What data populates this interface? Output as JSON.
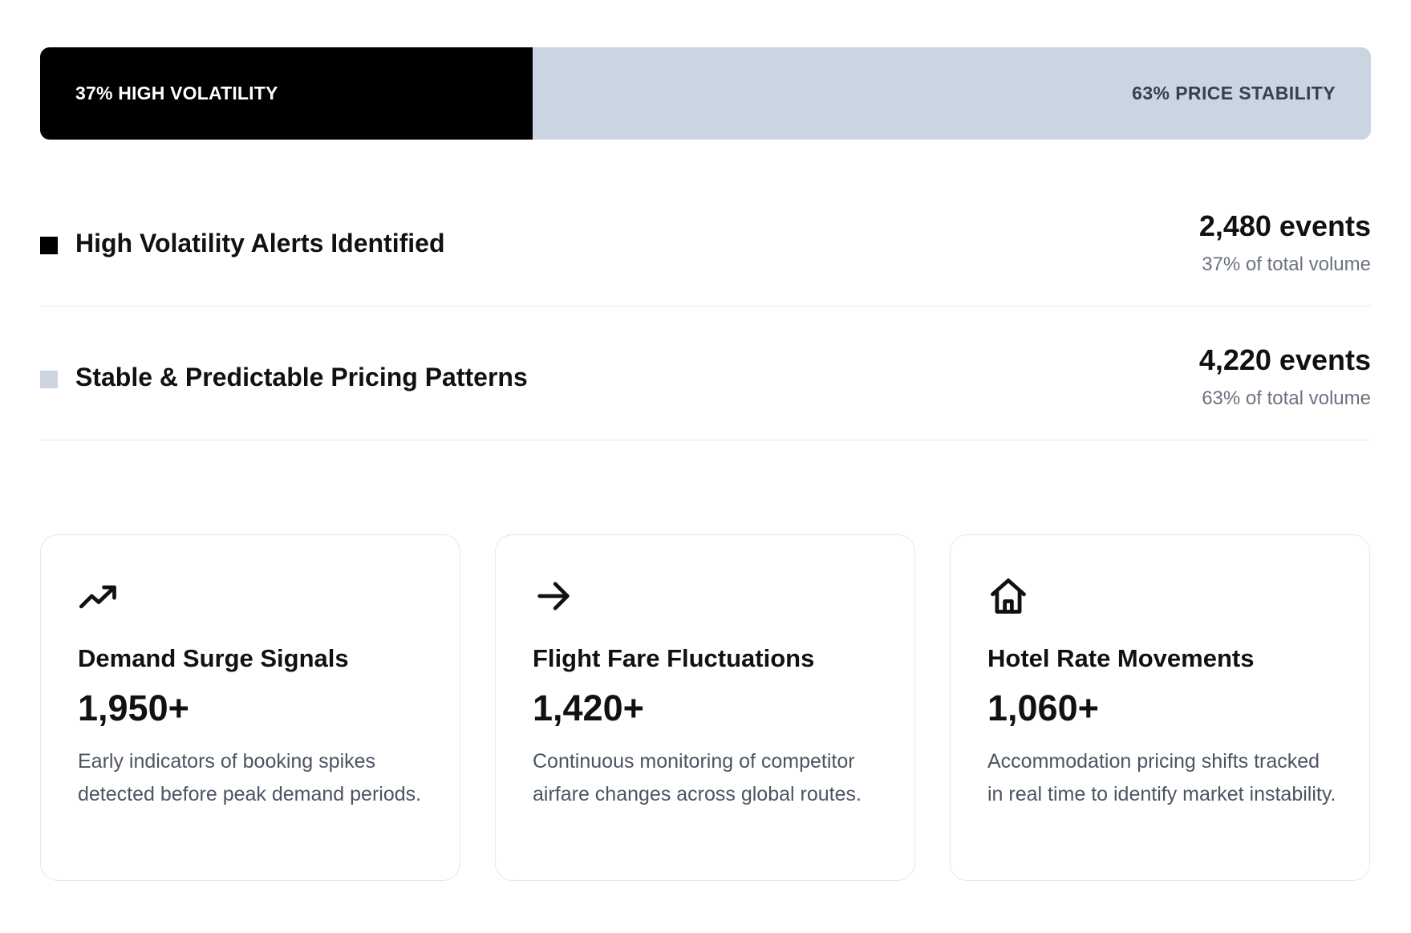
{
  "split_bar": {
    "volatility_label": "37% HIGH VOLATILITY",
    "stability_label": "63% PRICE STABILITY",
    "volatility_fraction": 0.37,
    "colors": {
      "volatility": "#000000",
      "stability": "#cbd5e1"
    }
  },
  "legend": [
    {
      "label": "High Volatility Alerts Identified",
      "value": "2,480 events",
      "share": "37% of total volume",
      "swatch_color": "#000000"
    },
    {
      "label": "Stable & Predictable Pricing Patterns",
      "value": "4,220 events",
      "share": "63% of total volume",
      "swatch_color": "#cbd5e1"
    }
  ],
  "cards": [
    {
      "icon": "trending-up-icon",
      "title": "Demand Surge Signals",
      "number": "1,950+",
      "description": "Early indicators of booking spikes detected before peak demand periods."
    },
    {
      "icon": "arrow-right-icon",
      "title": "Flight Fare Fluctuations",
      "number": "1,420+",
      "description": "Continuous monitoring of competitor airfare changes across global routes."
    },
    {
      "icon": "home-icon",
      "title": "Hotel Rate Movements",
      "number": "1,060+",
      "description": "Accommodation pricing shifts tracked in real time to identify market instability."
    }
  ]
}
